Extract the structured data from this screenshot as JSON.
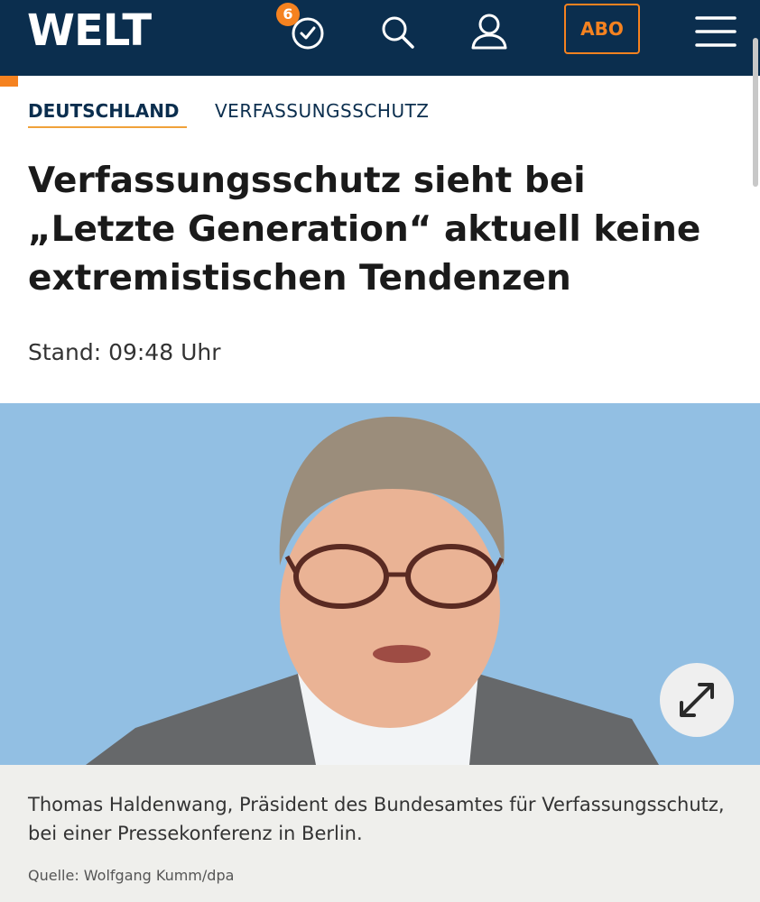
{
  "header": {
    "logo": "WELT",
    "notification_count": "6",
    "abo_label": "ABO",
    "icons": [
      "clock-check-icon",
      "search-icon",
      "user-icon",
      "menu-icon"
    ],
    "colors": {
      "background": "#0b2e4e",
      "accent": "#f58220"
    }
  },
  "breadcrumb": {
    "section": "DEUTSCHLAND",
    "topic": "VERFASSUNGSSCHUTZ"
  },
  "article": {
    "headline": "Verfassungsschutz sieht bei „Letzte Generation“ aktuell keine extremistischen Tendenzen",
    "stand": "Stand: 09:48 Uhr"
  },
  "image": {
    "expand_icon": "expand-arrows-icon",
    "caption": "Thomas Haldenwang, Präsident des Bundesamtes für Verfassungsschutz, bei einer Pressekonferenz in Berlin.",
    "source": "Quelle: Wolfgang Kumm/dpa"
  }
}
